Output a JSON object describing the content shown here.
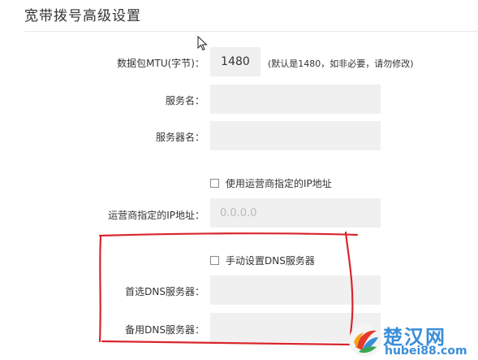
{
  "header": {
    "title": "宽带拨号高级设置"
  },
  "form": {
    "mtu": {
      "label": "数据包MTU(字节)：",
      "value": "1480",
      "hint": "(默认是1480，如非必要，请勿修改)"
    },
    "service_name": {
      "label": "服务名：",
      "value": ""
    },
    "server_name": {
      "label": "服务器名：",
      "value": ""
    },
    "use_isp_ip": {
      "label": "使用运营商指定的IP地址",
      "checked": false
    },
    "isp_ip": {
      "label": "运营商指定的IP地址：",
      "placeholder": "0.0.0.0"
    },
    "manual_dns": {
      "label": "手动设置DNS服务器",
      "checked": false
    },
    "primary_dns": {
      "label": "首选DNS服务器：",
      "value": ""
    },
    "secondary_dns": {
      "label": "备用DNS服务器：",
      "value": ""
    }
  },
  "watermark": {
    "name": "楚汉网",
    "domain": "hubei88.com"
  },
  "colors": {
    "field_bg": "#f0f0f0",
    "annotation": "#d9262c",
    "watermark": "#3a8ed8"
  }
}
